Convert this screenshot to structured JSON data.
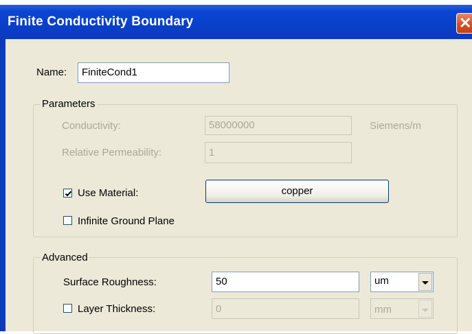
{
  "window": {
    "title": "Finite Conductivity Boundary",
    "close_glyph": "✕"
  },
  "name": {
    "label": "Name:",
    "value": "FiniteCond1"
  },
  "parameters": {
    "group_label": "Parameters",
    "conductivity_label": "Conductivity:",
    "conductivity_value": "58000000",
    "conductivity_unit": "Siemens/m",
    "permeability_label": "Relative Permeability:",
    "permeability_value": "1",
    "use_material_label": "Use Material:",
    "use_material_checked": true,
    "material_button": "copper",
    "ground_plane_label": "Infinite Ground Plane",
    "ground_plane_checked": false
  },
  "advanced": {
    "group_label": "Advanced",
    "roughness_label": "Surface Roughness:",
    "roughness_value": "50",
    "roughness_unit": "um",
    "thickness_label": "Layer Thickness:",
    "thickness_checked": false,
    "thickness_value": "0",
    "thickness_unit": "mm"
  },
  "colors": {
    "titlebar": "#0a46d4",
    "dialog_bg": "#ece9d8",
    "disabled_text": "#aca899",
    "close_button": "#d4502b"
  }
}
